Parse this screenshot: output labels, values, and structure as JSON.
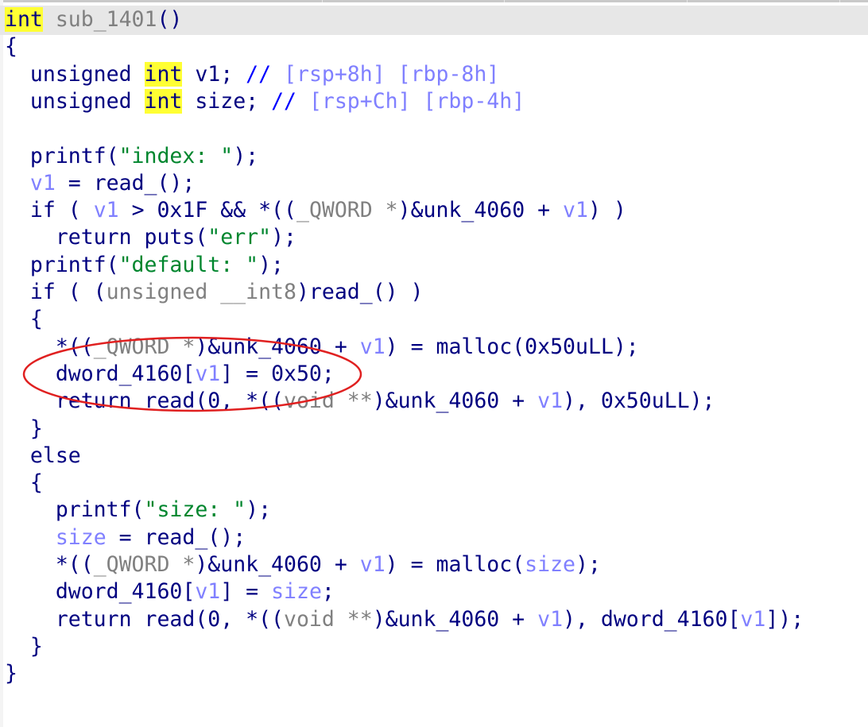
{
  "lines": [
    {
      "parts": [
        {
          "t": "int",
          "c": "kw hl"
        },
        {
          "t": " sub_1401",
          "c": "gray"
        },
        {
          "t": "()",
          "c": "punc"
        }
      ]
    },
    {
      "parts": [
        {
          "t": "{",
          "c": "punc"
        }
      ]
    },
    {
      "parts": [
        {
          "t": "  unsigned ",
          "c": "kw"
        },
        {
          "t": "int",
          "c": "kw hl"
        },
        {
          "t": " v1; ",
          "c": "plain"
        },
        {
          "t": "// ",
          "c": "cmt"
        },
        {
          "t": "[rsp+8h] [rbp-8h]",
          "c": "cmtaddr"
        }
      ]
    },
    {
      "parts": [
        {
          "t": "  unsigned ",
          "c": "kw"
        },
        {
          "t": "int",
          "c": "kw hl"
        },
        {
          "t": " size; ",
          "c": "plain"
        },
        {
          "t": "// ",
          "c": "cmt"
        },
        {
          "t": "[rsp+Ch] [rbp-4h]",
          "c": "cmtaddr"
        }
      ]
    },
    {
      "parts": [
        {
          "t": "",
          "c": "plain"
        }
      ]
    },
    {
      "parts": [
        {
          "t": "  printf(",
          "c": "fn"
        },
        {
          "t": "\"index: \"",
          "c": "str"
        },
        {
          "t": ");",
          "c": "punc"
        }
      ]
    },
    {
      "parts": [
        {
          "t": "  ",
          "c": "plain"
        },
        {
          "t": "v1",
          "c": "var"
        },
        {
          "t": " = read_();",
          "c": "plain"
        }
      ]
    },
    {
      "parts": [
        {
          "t": "  if ( ",
          "c": "kw"
        },
        {
          "t": "v1",
          "c": "var"
        },
        {
          "t": " > 0x1F && *((",
          "c": "plain"
        },
        {
          "t": "_QWORD *",
          "c": "gray"
        },
        {
          "t": ")&unk_4060 + ",
          "c": "plain"
        },
        {
          "t": "v1",
          "c": "var"
        },
        {
          "t": ") )",
          "c": "plain"
        }
      ]
    },
    {
      "parts": [
        {
          "t": "    return puts(",
          "c": "kw"
        },
        {
          "t": "\"err\"",
          "c": "str"
        },
        {
          "t": ");",
          "c": "punc"
        }
      ]
    },
    {
      "parts": [
        {
          "t": "  printf(",
          "c": "fn"
        },
        {
          "t": "\"default: \"",
          "c": "str"
        },
        {
          "t": ");",
          "c": "punc"
        }
      ]
    },
    {
      "parts": [
        {
          "t": "  if ( (",
          "c": "kw"
        },
        {
          "t": "unsigned __int8",
          "c": "gray"
        },
        {
          "t": ")read_() )",
          "c": "plain"
        }
      ]
    },
    {
      "parts": [
        {
          "t": "  {",
          "c": "punc"
        }
      ]
    },
    {
      "parts": [
        {
          "t": "    *((",
          "c": "plain"
        },
        {
          "t": "_QWORD *",
          "c": "gray"
        },
        {
          "t": ")&unk_4060 + ",
          "c": "plain"
        },
        {
          "t": "v1",
          "c": "var"
        },
        {
          "t": ") = malloc(0x50uLL);",
          "c": "plain"
        }
      ]
    },
    {
      "parts": [
        {
          "t": "    dword_4160[",
          "c": "plain"
        },
        {
          "t": "v1",
          "c": "var"
        },
        {
          "t": "] = 0x50;",
          "c": "plain"
        }
      ]
    },
    {
      "parts": [
        {
          "t": "    return read(0, *((",
          "c": "kw"
        },
        {
          "t": "void **",
          "c": "gray"
        },
        {
          "t": ")&unk_4060 + ",
          "c": "plain"
        },
        {
          "t": "v1",
          "c": "var"
        },
        {
          "t": "), 0x50uLL);",
          "c": "plain"
        }
      ]
    },
    {
      "parts": [
        {
          "t": "  }",
          "c": "punc"
        }
      ]
    },
    {
      "parts": [
        {
          "t": "  else",
          "c": "kw"
        }
      ]
    },
    {
      "parts": [
        {
          "t": "  {",
          "c": "punc"
        }
      ]
    },
    {
      "parts": [
        {
          "t": "    printf(",
          "c": "fn"
        },
        {
          "t": "\"size: \"",
          "c": "str"
        },
        {
          "t": ");",
          "c": "punc"
        }
      ]
    },
    {
      "parts": [
        {
          "t": "    ",
          "c": "plain"
        },
        {
          "t": "size",
          "c": "var"
        },
        {
          "t": " = read_();",
          "c": "plain"
        }
      ]
    },
    {
      "parts": [
        {
          "t": "    *((",
          "c": "plain"
        },
        {
          "t": "_QWORD *",
          "c": "gray"
        },
        {
          "t": ")&unk_4060 + ",
          "c": "plain"
        },
        {
          "t": "v1",
          "c": "var"
        },
        {
          "t": ") = malloc(",
          "c": "plain"
        },
        {
          "t": "size",
          "c": "var"
        },
        {
          "t": ");",
          "c": "plain"
        }
      ]
    },
    {
      "parts": [
        {
          "t": "    dword_4160[",
          "c": "plain"
        },
        {
          "t": "v1",
          "c": "var"
        },
        {
          "t": "] = ",
          "c": "plain"
        },
        {
          "t": "size",
          "c": "var"
        },
        {
          "t": ";",
          "c": "plain"
        }
      ]
    },
    {
      "parts": [
        {
          "t": "    return read(0, *((",
          "c": "kw"
        },
        {
          "t": "void **",
          "c": "gray"
        },
        {
          "t": ")&unk_4060 + ",
          "c": "plain"
        },
        {
          "t": "v1",
          "c": "var"
        },
        {
          "t": "), dword_4160[",
          "c": "plain"
        },
        {
          "t": "v1",
          "c": "var"
        },
        {
          "t": "]);",
          "c": "plain"
        }
      ]
    },
    {
      "parts": [
        {
          "t": "  }",
          "c": "punc"
        }
      ]
    },
    {
      "parts": [
        {
          "t": "}",
          "c": "punc"
        }
      ]
    }
  ],
  "colors": {
    "keyword_highlight": "#ffff33",
    "string": "#00862e",
    "variable": "#8080ff",
    "type_gray": "#808080",
    "annotation_ellipse": "#e02020",
    "current_line": "#e7e7e7"
  }
}
